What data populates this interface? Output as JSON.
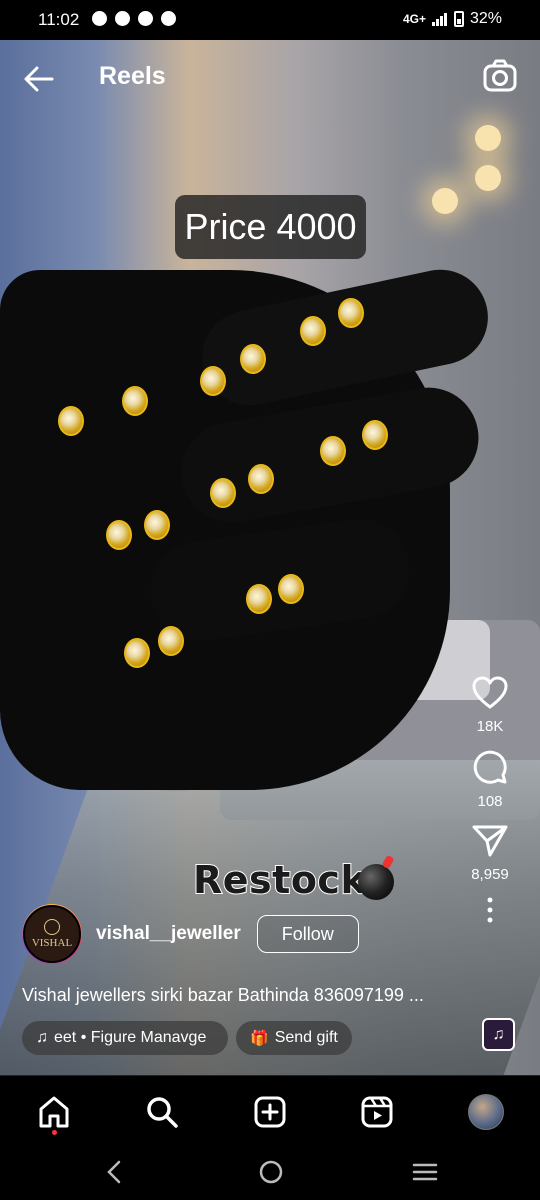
{
  "status": {
    "time": "11:02",
    "network": "4G+",
    "battery": "32%",
    "notification_icons": [
      "chat-icon",
      "vpn-icon",
      "chrome-icon",
      "vpn-icon"
    ]
  },
  "header": {
    "title": "Reels"
  },
  "reel": {
    "price_overlay": "Price 4000",
    "sticker_text": "Restock",
    "likes": "18K",
    "comments": "108",
    "shares": "8,959",
    "author": {
      "username": "vishal__jeweller",
      "avatar_text": "VISHAL",
      "follow_label": "Follow"
    },
    "caption": "Vishal jewellers sirki bazar Bathinda 836097199 ...",
    "audio_label": "eet • Figure   Manavge",
    "gift_label": "Send gift"
  },
  "nav": {
    "items": [
      "home-icon",
      "search-icon",
      "create-icon",
      "reels-icon",
      "profile-avatar"
    ]
  },
  "colors": {
    "accent_notification": "#ff3040",
    "gold": "#d4a71c"
  }
}
